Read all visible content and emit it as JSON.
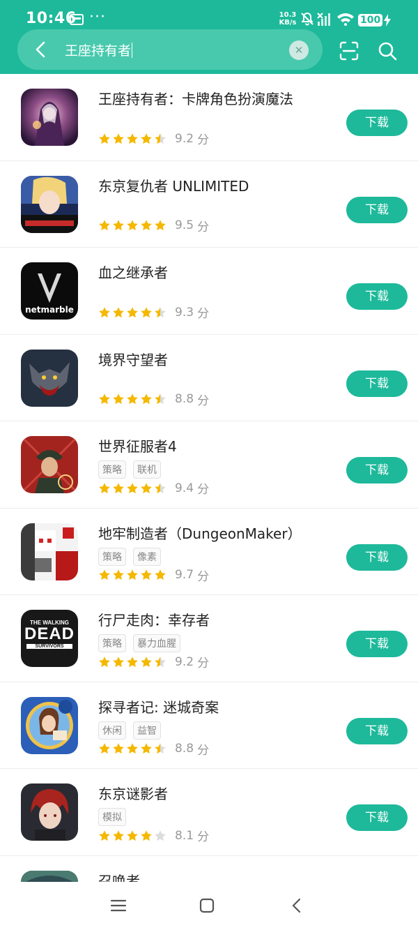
{
  "status_bar": {
    "time": "10:46",
    "dots": "···",
    "net_speed": "10.3",
    "net_unit": "KB/s",
    "battery": "100"
  },
  "search": {
    "query": "王座持有者"
  },
  "colors": {
    "accent": "#1db99a",
    "star": "#f5b800"
  },
  "download_label": "下载",
  "score_unit": "分",
  "apps": [
    {
      "name": "王座持有者：卡牌角色扮演魔法",
      "tags": [],
      "rating": 4.5,
      "score": "9.2",
      "icon": "throne-holder-icon"
    },
    {
      "name": "东京复仇者 UNLIMITED",
      "tags": [],
      "rating": 5,
      "score": "9.5",
      "icon": "tokyo-revengers-icon"
    },
    {
      "name": "血之继承者",
      "tags": [],
      "rating": 4.5,
      "score": "9.3",
      "icon": "netmarble-v-icon",
      "icon_text": "netmarble"
    },
    {
      "name": "境界守望者",
      "tags": [],
      "rating": 4.5,
      "score": "8.8",
      "icon": "werewolf-icon"
    },
    {
      "name": "世界征服者4",
      "tags": [
        "策略",
        "联机"
      ],
      "rating": 4.5,
      "score": "9.4",
      "icon": "world-conqueror-icon"
    },
    {
      "name": "地牢制造者（DungeonMaker）",
      "tags": [
        "策略",
        "像素"
      ],
      "rating": 5,
      "score": "9.7",
      "icon": "dungeon-maker-icon"
    },
    {
      "name": "行尸走肉：幸存者",
      "tags": [
        "策略",
        "暴力血腥"
      ],
      "rating": 4.5,
      "score": "9.2",
      "icon": "walking-dead-icon",
      "icon_text": [
        "THE WALKING",
        "DEAD",
        "SURVIVORS"
      ]
    },
    {
      "name": "探寻者记: 迷城奇案",
      "tags": [
        "休闲",
        "益智"
      ],
      "rating": 4.5,
      "score": "8.8",
      "icon": "seekers-notes-icon"
    },
    {
      "name": "东京谜影者",
      "tags": [
        "模拟"
      ],
      "rating": 4,
      "score": "8.1",
      "icon": "tokyo-mystery-icon"
    },
    {
      "name": "召唤者",
      "tags": [],
      "rating": 0,
      "score": "",
      "icon": "summoner-icon"
    }
  ]
}
